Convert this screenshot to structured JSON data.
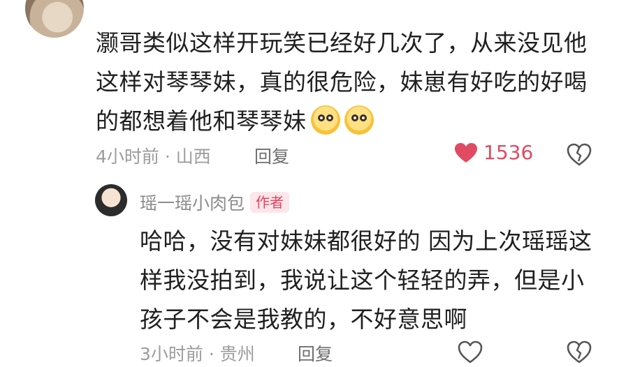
{
  "comment": {
    "text_line1": "灏哥类似这样开玩笑已经好几次了，从来没见他",
    "text_line2": "这样对琴琴妹，真的很危险，妹崽有好吃的好喝",
    "text_line3": "的都想着他和琴琴妹",
    "emojis": [
      "pleading-face-emoji",
      "pleading-face-emoji"
    ],
    "time_location": "4小时前 · 山西",
    "reply_label": "回复",
    "like_count": "1536",
    "colors": {
      "text": "#1f1f1f",
      "meta": "#9c9c9c",
      "like": "#e04a62"
    },
    "icons": {
      "like": "heart-filled-icon",
      "dislike": "broken-heart-icon"
    }
  },
  "reply": {
    "author": "瑶一瑶小肉包",
    "badge": "作者",
    "text_line1": "哈哈，没有对妹妹都很好的 因为上次瑶瑶这",
    "text_line2": "样我没拍到，我说让这个轻轻的弄，但是小",
    "text_line3": "孩子不会是我教的，不好意思啊",
    "time_location": "3小时前 · 贵州",
    "reply_label": "回复",
    "colors": {
      "badge_text": "#e0435f",
      "badge_bg": "#fde6ea"
    },
    "icons": {
      "like": "heart-outline-icon",
      "dislike": "broken-heart-icon"
    }
  }
}
